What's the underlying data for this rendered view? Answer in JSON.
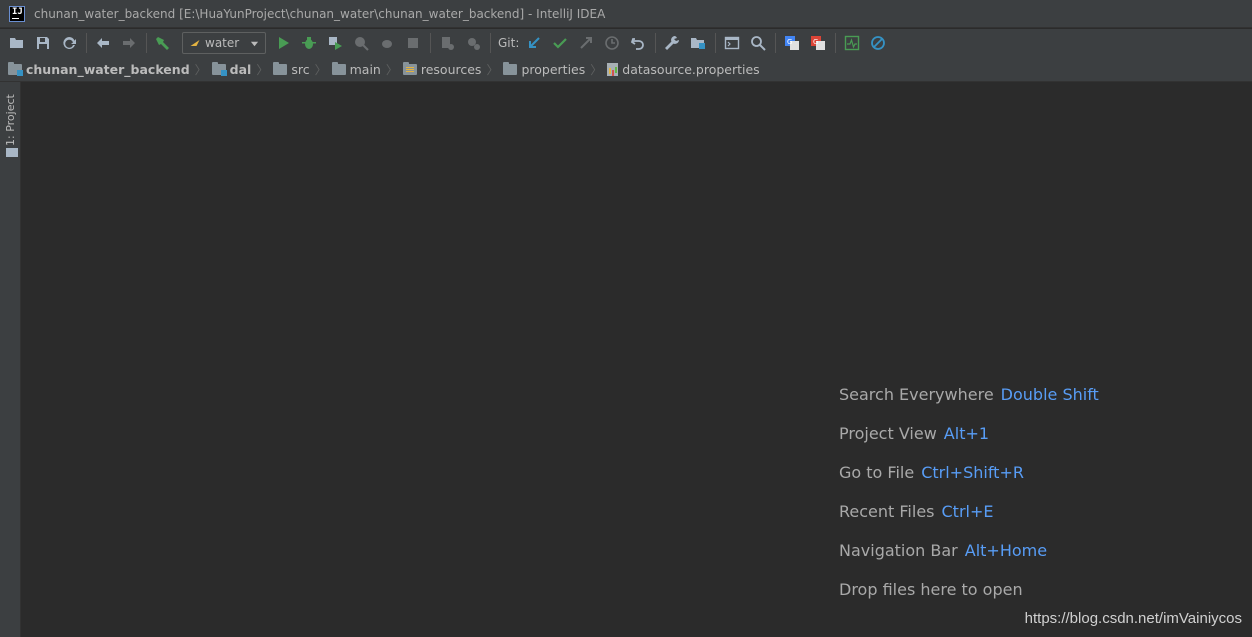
{
  "titlebar": {
    "title": "chunan_water_backend [E:\\HuaYunProject\\chunan_water\\chunan_water_backend] - IntelliJ IDEA"
  },
  "toolbar": {
    "run_config": "water",
    "git_label": "Git:"
  },
  "navbar": {
    "crumbs": [
      "chunan_water_backend",
      "dal",
      "src",
      "main",
      "resources",
      "properties",
      "datasource.properties"
    ]
  },
  "left_strip": {
    "project_tab": "1: Project"
  },
  "editor": {
    "hints": [
      {
        "label": "Search Everywhere",
        "shortcut": "Double Shift"
      },
      {
        "label": "Project View",
        "shortcut": "Alt+1"
      },
      {
        "label": "Go to File",
        "shortcut": "Ctrl+Shift+R"
      },
      {
        "label": "Recent Files",
        "shortcut": "Ctrl+E"
      },
      {
        "label": "Navigation Bar",
        "shortcut": "Alt+Home"
      }
    ],
    "drop_text": "Drop files here to open"
  },
  "watermark": "https://blog.csdn.net/imVainiycos",
  "colors": {
    "background": "#2b2b2b",
    "chrome": "#3c3f41",
    "shortcut": "#589df6",
    "run": "#499c54"
  }
}
